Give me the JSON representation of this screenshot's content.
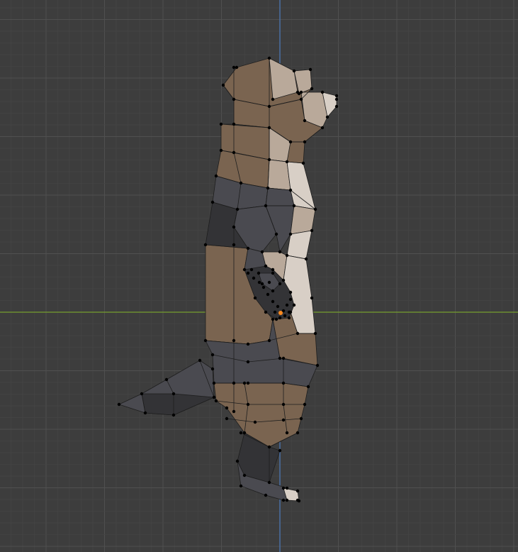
{
  "viewport": {
    "view": "side",
    "background_color": "#3d3d3d",
    "grid": {
      "minor_color": "#454545",
      "major_color": "#505050",
      "x_axis_color": "#6d8f30",
      "z_axis_color": "#4a6fa3"
    }
  },
  "mesh": {
    "object": "meerkat",
    "edit_mode": true,
    "vertex_color": "#000000",
    "active_vertex_color": "#ff8a1e",
    "edge_color": "#1e1e1e",
    "face_colors": {
      "fur_brown": "#7a6450",
      "fur_dark": "#4a4a50",
      "fur_light": "#b9a99a",
      "belly_light": "#d8cfc6",
      "shadow": "#333336"
    }
  }
}
